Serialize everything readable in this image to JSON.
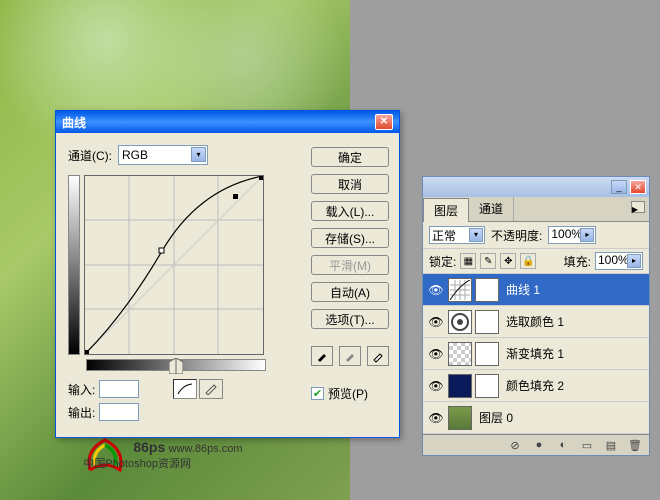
{
  "curves_dialog": {
    "title": "曲线",
    "channel_label": "通道(C):",
    "channel_value": "RGB",
    "input_label": "输入:",
    "output_label": "输出:",
    "buttons": {
      "ok": "确定",
      "cancel": "取消",
      "load": "载入(L)...",
      "save": "存储(S)...",
      "smooth": "平滑(M)",
      "auto": "自动(A)",
      "options": "选项(T)..."
    },
    "preview_label": "预览(P)",
    "preview_checked": true
  },
  "layers_palette": {
    "tabs": [
      "图层",
      "通道"
    ],
    "active_tab": 0,
    "blend_mode": "正常",
    "opacity_label": "不透明度:",
    "opacity_value": "100%",
    "lock_label": "锁定:",
    "fill_label": "填充:",
    "fill_value": "100%",
    "layers": [
      {
        "name": "曲线 1",
        "type": "curves",
        "selected": true
      },
      {
        "name": "选取颜色 1",
        "type": "selcolor",
        "selected": false
      },
      {
        "name": "渐变填充 1",
        "type": "gradfill",
        "selected": false
      },
      {
        "name": "颜色填充 2",
        "type": "colorfill",
        "selected": false
      },
      {
        "name": "图层 0",
        "type": "image",
        "selected": false
      }
    ]
  },
  "watermark": {
    "brand": "86ps",
    "url": "www.86ps.com",
    "tagline": "中国Photoshop资源网"
  },
  "chart_data": {
    "type": "line",
    "title": "曲线",
    "xlabel": "输入",
    "ylabel": "输出",
    "x": [
      0,
      64,
      128,
      192,
      255
    ],
    "y": [
      0,
      90,
      160,
      215,
      255
    ],
    "xlim": [
      0,
      255
    ],
    "ylim": [
      0,
      255
    ],
    "grid": true,
    "control_points": [
      {
        "in": 0,
        "out": 0
      },
      {
        "in": 110,
        "out": 148
      },
      {
        "in": 215,
        "out": 230
      },
      {
        "in": 255,
        "out": 255
      }
    ]
  }
}
